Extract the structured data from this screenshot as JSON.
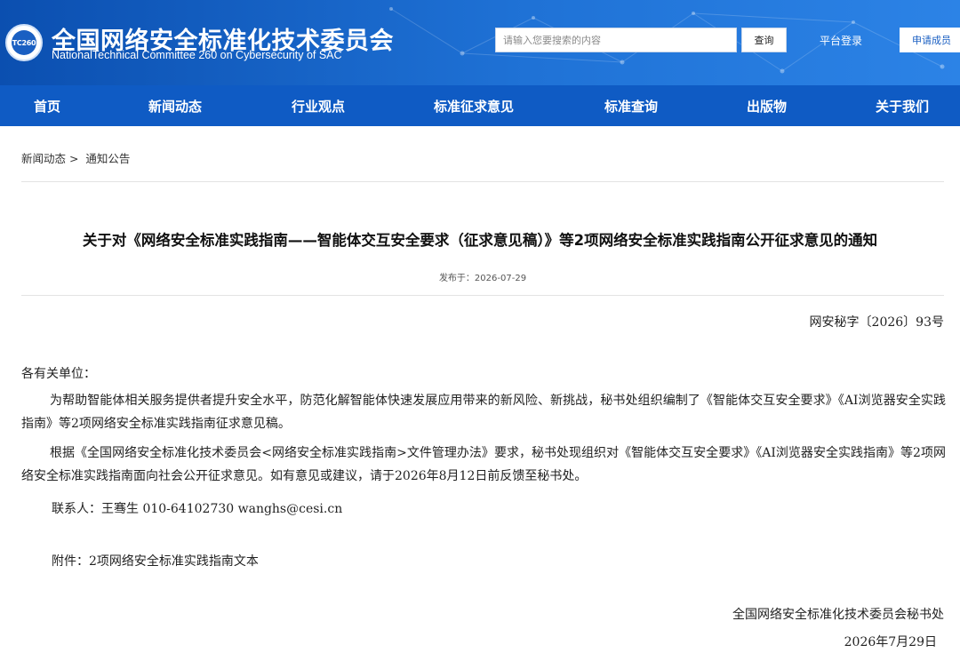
{
  "header": {
    "logo_text": "TC260",
    "title": "全国网络安全标准化技术委员会",
    "subtitle": "NationalTechnical Committee 260 on Cybersecurity of SAC",
    "search_placeholder": "请输入您要搜索的内容",
    "search_button": "查询",
    "login_link": "平台登录",
    "apply_button": "申请成员",
    "colors": {
      "header_start": "#0b4fb0",
      "header_end": "#2c83e6",
      "nav": "#0f5bc4"
    }
  },
  "nav": {
    "items": [
      {
        "label": "首页"
      },
      {
        "label": "新闻动态"
      },
      {
        "label": "行业观点"
      },
      {
        "label": "标准征求意见"
      },
      {
        "label": "标准查询"
      },
      {
        "label": "出版物"
      },
      {
        "label": "关于我们"
      }
    ]
  },
  "breadcrumb": {
    "level1": "新闻动态 >",
    "level2": "通知公告"
  },
  "article": {
    "title": "关于对《网络安全标准实践指南——智能体交互安全要求（征求意见稿）》等2项网络安全标准实践指南公开征求意见的通知",
    "publish_date": "发布于：2026-07-29",
    "doc_number": "网安秘字〔2026〕93号",
    "salutation": "各有关单位：",
    "paragraph1": "为帮助智能体相关服务提供者提升安全水平，防范化解智能体快速发展应用带来的新风险、新挑战，秘书处组织编制了《智能体交互安全要求》《AI浏览器安全实践指南》等2项网络安全标准实践指南征求意见稿。",
    "paragraph2": "根据《全国网络安全标准化技术委员会<网络安全标准实践指南>文件管理办法》要求，秘书处现组织对《智能体交互安全要求》《AI浏览器安全实践指南》等2项网络安全标准实践指南面向社会公开征求意见。如有意见或建议，请于2026年8月12日前反馈至秘书处。",
    "contact": "联系人：王骞生 010-64102730 wanghs@cesi.cn",
    "attachment": "附件：2项网络安全标准实践指南文本",
    "signature": "全国网络安全标准化技术委员会秘书处",
    "sign_date": "2026年7月29日"
  }
}
